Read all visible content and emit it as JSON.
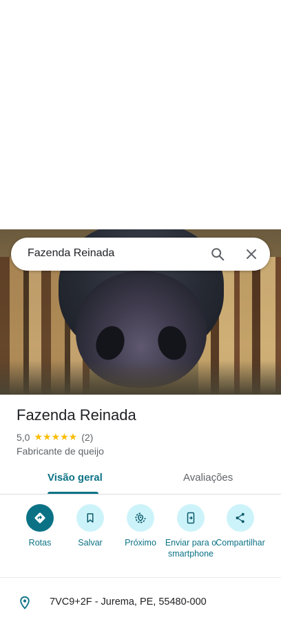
{
  "search": {
    "query": "Fazenda Reinada"
  },
  "place": {
    "name": "Fazenda Reinada",
    "rating": "5,0",
    "stars": "★★★★★",
    "review_count": "(2)",
    "category": "Fabricante de queijo"
  },
  "tabs": [
    {
      "label": "Visão geral",
      "selected": true
    },
    {
      "label": "Avaliações",
      "selected": false
    }
  ],
  "actions": [
    {
      "label": "Rotas",
      "icon": "directions-icon"
    },
    {
      "label": "Salvar",
      "icon": "bookmark-icon"
    },
    {
      "label": "Próximo",
      "icon": "nearby-icon"
    },
    {
      "label": "Enviar para o smartphone",
      "icon": "send-to-phone-icon"
    },
    {
      "label": "Compartilhar",
      "icon": "share-icon"
    }
  ],
  "address": "7VC9+2F - Jurema, PE, 55480-000",
  "colors": {
    "accent": "#0b7285",
    "action_bg": "#cdf3fa",
    "star": "#fbbc04"
  }
}
